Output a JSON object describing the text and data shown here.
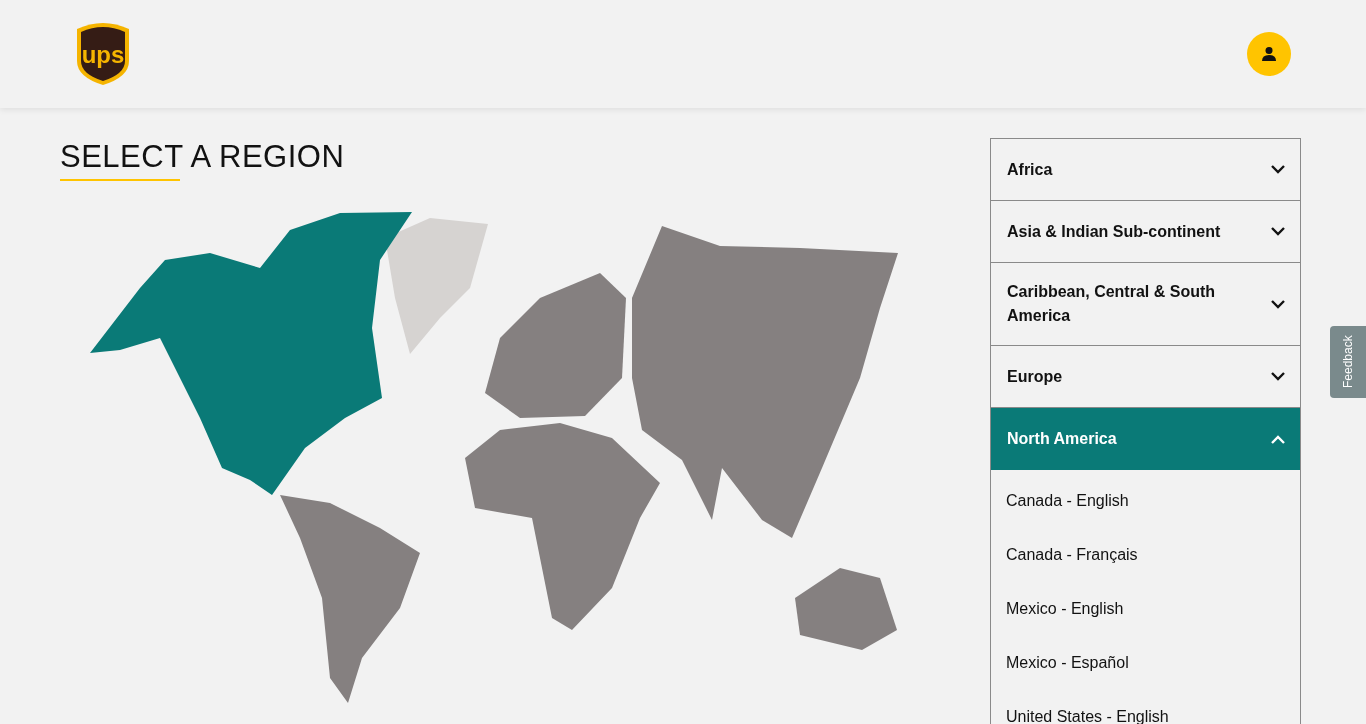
{
  "header": {
    "logo_text": "ups"
  },
  "title": "SELECT A REGION",
  "regions": [
    {
      "name": "Africa",
      "expanded": false
    },
    {
      "name": "Asia & Indian Sub-continent",
      "expanded": false
    },
    {
      "name": "Caribbean, Central & South America",
      "expanded": false
    },
    {
      "name": "Europe",
      "expanded": false
    },
    {
      "name": "North America",
      "expanded": true,
      "links": [
        "Canada - English",
        "Canada - Français",
        "Mexico - English",
        "Mexico - Español",
        "United States - English"
      ]
    }
  ],
  "feedback": "Feedback"
}
